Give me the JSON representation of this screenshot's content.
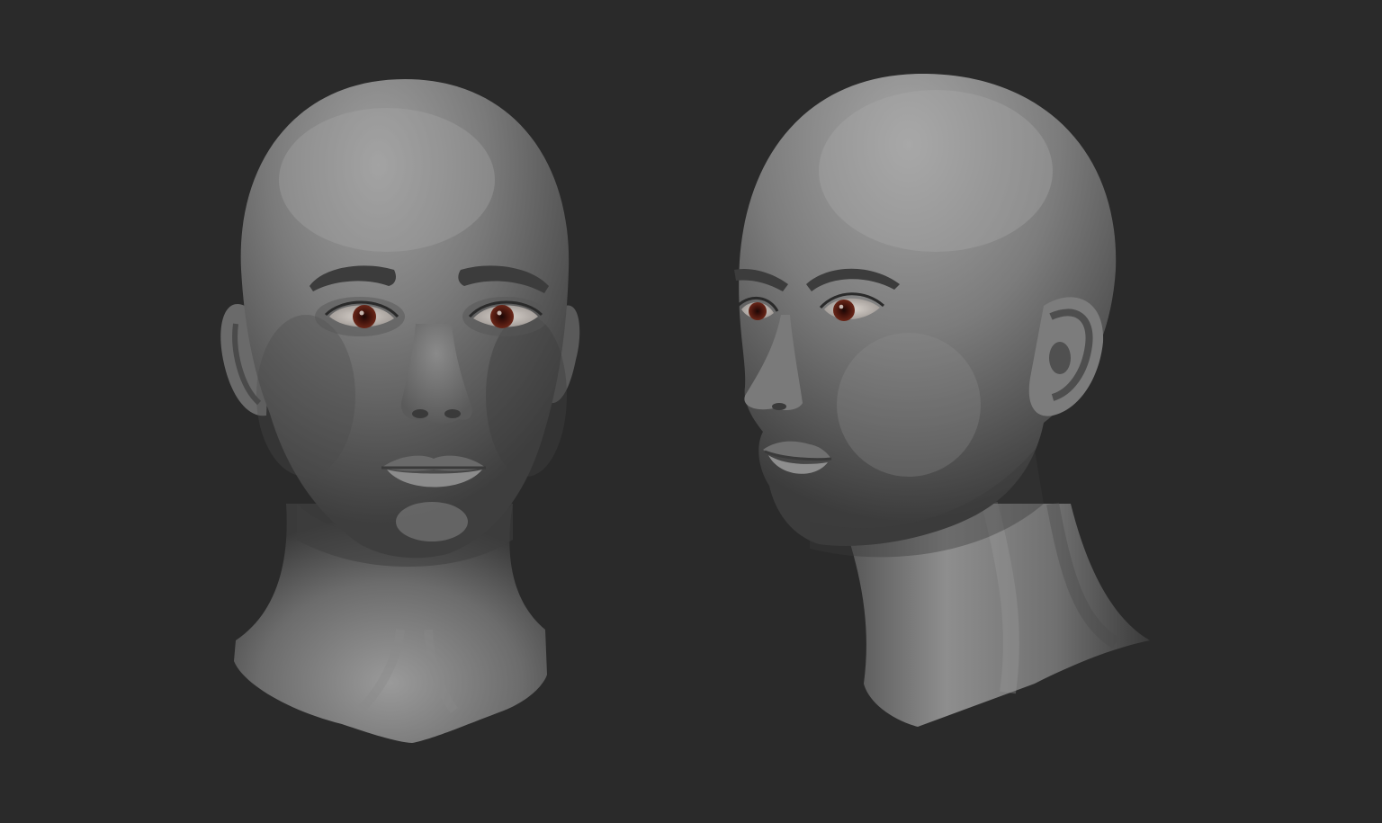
{
  "scene": {
    "background_color": "#2a2a2a",
    "views": [
      {
        "view": "front",
        "skin_base_color": "#6e6e6e",
        "skin_highlight_color": "#9a9a9a",
        "skin_shadow_color": "#3c3c3c",
        "iris_color": "#5a1e14",
        "brow_color": "#3a3a3a"
      },
      {
        "view": "three-quarter",
        "skin_base_color": "#6e6e6e",
        "skin_highlight_color": "#9c9c9c",
        "skin_shadow_color": "#3a3a3a",
        "iris_color": "#5a1e14",
        "brow_color": "#3a3a3a"
      }
    ]
  }
}
